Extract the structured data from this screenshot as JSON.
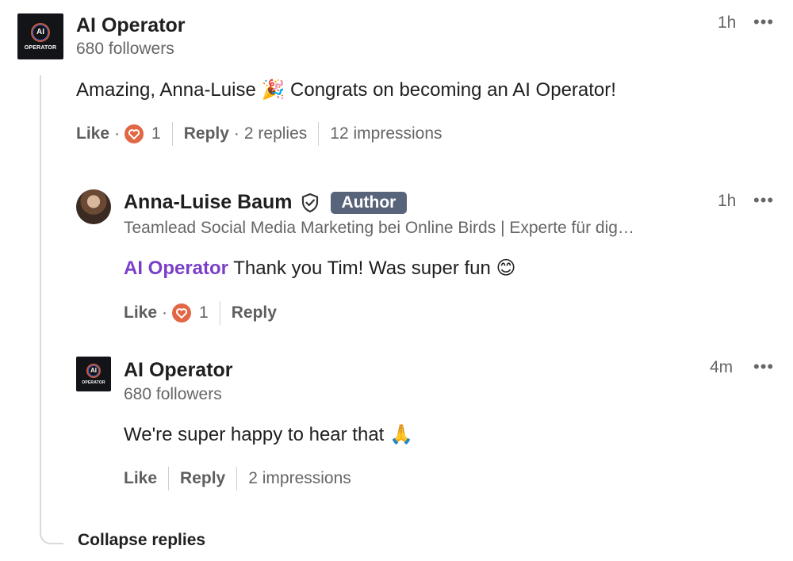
{
  "comment": {
    "author": "AI Operator",
    "logo_initials": "AI",
    "logo_word": "OPERATOR",
    "followers": "680 followers",
    "time": "1h",
    "text": "Amazing, Anna-Luise 🎉 Congrats on becoming an AI Operator!",
    "like_label": "Like",
    "reaction_count": "1",
    "reply_label": "Reply",
    "replies_count": "2 replies",
    "impressions": "12 impressions"
  },
  "replies": [
    {
      "author": "Anna-Luise Baum",
      "badge": "Author",
      "headline": "Teamlead Social Media Marketing bei Online Birds | Experte für dig…",
      "time": "1h",
      "mention": "AI Operator",
      "text": "Thank you Tim! Was super fun 😊",
      "like_label": "Like",
      "reaction_count": "1",
      "reply_label": "Reply"
    },
    {
      "author": "AI Operator",
      "logo_initials": "AI",
      "logo_word": "OPERATOR",
      "followers": "680 followers",
      "time": "4m",
      "text": "We're super happy to hear that 🙏",
      "like_label": "Like",
      "reply_label": "Reply",
      "impressions": "2 impressions"
    }
  ],
  "collapse_label": "Collapse replies",
  "more_icon": "•••",
  "colors": {
    "mention": "#7a3fc9",
    "heart_reaction": "#e16745",
    "badge_bg": "#58647a"
  }
}
